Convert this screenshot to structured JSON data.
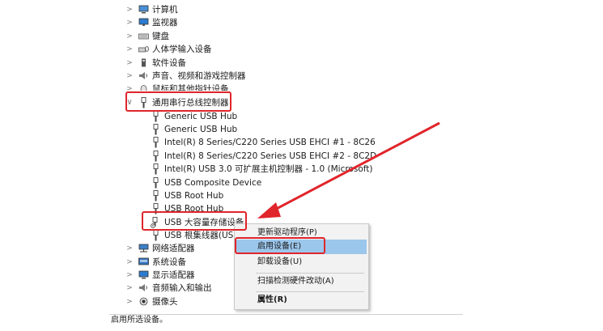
{
  "tree": {
    "collapsed_top": [
      {
        "label": "计算机",
        "icon": "computer-icon"
      },
      {
        "label": "监视器",
        "icon": "monitor-icon"
      },
      {
        "label": "键盘",
        "icon": "keyboard-icon"
      },
      {
        "label": "人体学输入设备",
        "icon": "hid-icon"
      },
      {
        "label": "软件设备",
        "icon": "software-device-icon"
      },
      {
        "label": "声音、视频和游戏控制器",
        "icon": "speaker-icon"
      },
      {
        "label": "鼠标和其他指针设备",
        "icon": "mouse-icon"
      }
    ],
    "expanded_group": {
      "label": "通用串行总线控制器",
      "icon": "usb-icon"
    },
    "usb_children": [
      "Generic USB Hub",
      "Generic USB Hub",
      "Intel(R) 8 Series/C220 Series USB EHCI #1 - 8C26",
      "Intel(R) 8 Series/C220 Series USB EHCI #2 - 8C2D",
      "Intel(R) USB 3.0 可扩展主机控制器 - 1.0 (Microsoft)",
      "USB Composite Device",
      "USB Root Hub",
      "USB Root Hub",
      "USB 大容量存储设备",
      "USB 根集线器(USB 3.0)"
    ],
    "collapsed_bottom": [
      {
        "label": "网络适配器",
        "icon": "network-icon"
      },
      {
        "label": "系统设备",
        "icon": "system-icon"
      },
      {
        "label": "显示适配器",
        "icon": "display-icon"
      },
      {
        "label": "音频输入和输出",
        "icon": "audio-icon"
      },
      {
        "label": "摄像头",
        "icon": "camera-icon"
      }
    ]
  },
  "context_menu": {
    "items": [
      {
        "label": "更新驱动程序(P)",
        "bold": false
      },
      {
        "label": "启用设备(E)",
        "bold": false,
        "highlighted": true
      },
      {
        "label": "卸载设备(U)",
        "bold": false
      },
      {
        "label": "扫描检测硬件改动(A)",
        "bold": false
      },
      {
        "label": "属性(R)",
        "bold": true
      }
    ]
  },
  "status_bar": {
    "text": "启用所选设备。"
  },
  "colors": {
    "highlight_box": "#e0252b",
    "menu_hover": "#9cc7ec",
    "arrow": "#e0252b"
  }
}
